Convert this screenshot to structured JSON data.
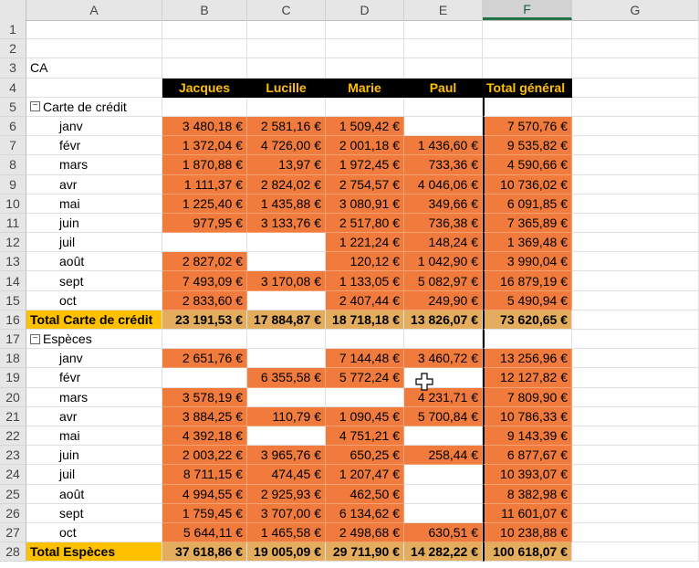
{
  "columns": [
    "A",
    "B",
    "C",
    "D",
    "E",
    "F",
    "G"
  ],
  "selected_column": "F",
  "title_cell": "CA",
  "header_row": [
    "Jacques",
    "Lucille",
    "Marie",
    "Paul",
    "Total général"
  ],
  "groups": [
    {
      "name": "Carte de crédit",
      "collapse_icon": "collapse-minus-icon",
      "rows": [
        {
          "label": "janv",
          "values": [
            "3 480,18 €",
            "2 581,16 €",
            "1 509,42 €",
            "",
            "7 570,76 €"
          ]
        },
        {
          "label": "févr",
          "values": [
            "1 372,04 €",
            "4 726,00 €",
            "2 001,18 €",
            "1 436,60 €",
            "9 535,82 €"
          ]
        },
        {
          "label": "mars",
          "values": [
            "1 870,88 €",
            "13,97 €",
            "1 972,45 €",
            "733,36 €",
            "4 590,66 €"
          ]
        },
        {
          "label": "avr",
          "values": [
            "1 111,37 €",
            "2 824,02 €",
            "2 754,57 €",
            "4 046,06 €",
            "10 736,02 €"
          ]
        },
        {
          "label": "mai",
          "values": [
            "1 225,40 €",
            "1 435,88 €",
            "3 080,91 €",
            "349,66 €",
            "6 091,85 €"
          ]
        },
        {
          "label": "juin",
          "values": [
            "977,95 €",
            "3 133,76 €",
            "2 517,80 €",
            "736,38 €",
            "7 365,89 €"
          ]
        },
        {
          "label": "juil",
          "values": [
            "",
            "",
            "1 221,24 €",
            "148,24 €",
            "1 369,48 €"
          ]
        },
        {
          "label": "août",
          "values": [
            "2 827,02 €",
            "",
            "120,12 €",
            "1 042,90 €",
            "3 990,04 €"
          ]
        },
        {
          "label": "sept",
          "values": [
            "7 493,09 €",
            "3 170,08 €",
            "1 133,05 €",
            "5 082,97 €",
            "16 879,19 €"
          ]
        },
        {
          "label": "oct",
          "values": [
            "2 833,60 €",
            "",
            "2 407,44 €",
            "249,90 €",
            "5 490,94 €"
          ]
        }
      ],
      "total_label": "Total Carte de crédit",
      "totals": [
        "23 191,53 €",
        "17 884,87 €",
        "18 718,18 €",
        "13 826,07 €",
        "73 620,65 €"
      ]
    },
    {
      "name": "Espèces",
      "collapse_icon": "collapse-minus-icon",
      "rows": [
        {
          "label": "janv",
          "values": [
            "2 651,76 €",
            "",
            "7 144,48 €",
            "3 460,72 €",
            "13 256,96 €"
          ]
        },
        {
          "label": "févr",
          "values": [
            "",
            "6 355,58 €",
            "5 772,24 €",
            "",
            "12 127,82 €"
          ]
        },
        {
          "label": "mars",
          "values": [
            "3 578,19 €",
            "",
            "",
            "4 231,71 €",
            "7 809,90 €"
          ]
        },
        {
          "label": "avr",
          "values": [
            "3 884,25 €",
            "110,79 €",
            "1 090,45 €",
            "5 700,84 €",
            "10 786,33 €"
          ]
        },
        {
          "label": "mai",
          "values": [
            "4 392,18 €",
            "",
            "4 751,21 €",
            "",
            "9 143,39 €"
          ]
        },
        {
          "label": "juin",
          "values": [
            "2 003,22 €",
            "3 965,76 €",
            "650,25 €",
            "258,44 €",
            "6 877,67 €"
          ]
        },
        {
          "label": "juil",
          "values": [
            "8 711,15 €",
            "474,45 €",
            "1 207,47 €",
            "",
            "10 393,07 €"
          ]
        },
        {
          "label": "août",
          "values": [
            "4 994,55 €",
            "2 925,93 €",
            "462,50 €",
            "",
            "8 382,98 €"
          ]
        },
        {
          "label": "sept",
          "values": [
            "1 759,45 €",
            "3 707,00 €",
            "6 134,62 €",
            "",
            "11 601,07 €"
          ]
        },
        {
          "label": "oct",
          "values": [
            "5 644,11 €",
            "1 465,58 €",
            "2 498,68 €",
            "630,51 €",
            "10 238,88 €"
          ]
        }
      ],
      "total_label": "Total Espèces",
      "totals": [
        "37 618,86 €",
        "19 005,09 €",
        "29 711,90 €",
        "14 282,22 €",
        "100 618,07 €"
      ]
    }
  ],
  "colors": {
    "orange": "#f07b3c",
    "gold": "#ffc000",
    "header_bg": "#000000"
  },
  "cursor_icon": "cell-select-cross-icon"
}
